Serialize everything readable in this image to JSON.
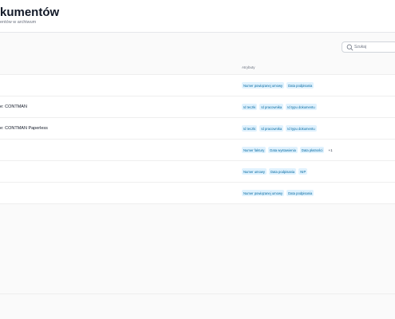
{
  "header": {
    "title": "kumentów",
    "subtitle": "entów w archiwum"
  },
  "search": {
    "placeholder": "Szukaj"
  },
  "table": {
    "columns": {
      "attributes": "Atrybuty"
    },
    "rows": [
      {
        "name": "",
        "tags": [
          "Numer powiązanej umowy",
          "Data podpisania"
        ],
        "more": ""
      },
      {
        "name": "e: CONTMAN",
        "tags": [
          "Id teczki",
          "Id pracownika",
          "Id typu dokumentu"
        ],
        "more": ""
      },
      {
        "name": "e: CONTMAN Paperless",
        "tags": [
          "Id teczki",
          "Id pracownika",
          "Id typu dokumentu"
        ],
        "more": ""
      },
      {
        "name": "",
        "tags": [
          "Numer faktury",
          "Data wystawienia",
          "Data płatności"
        ],
        "more": "+1"
      },
      {
        "name": "",
        "tags": [
          "Numer umowy",
          "Data podpisania",
          "NIP"
        ],
        "more": ""
      },
      {
        "name": "",
        "tags": [
          "Numer powiązanej umowy",
          "Data podpisania"
        ],
        "more": ""
      }
    ]
  }
}
